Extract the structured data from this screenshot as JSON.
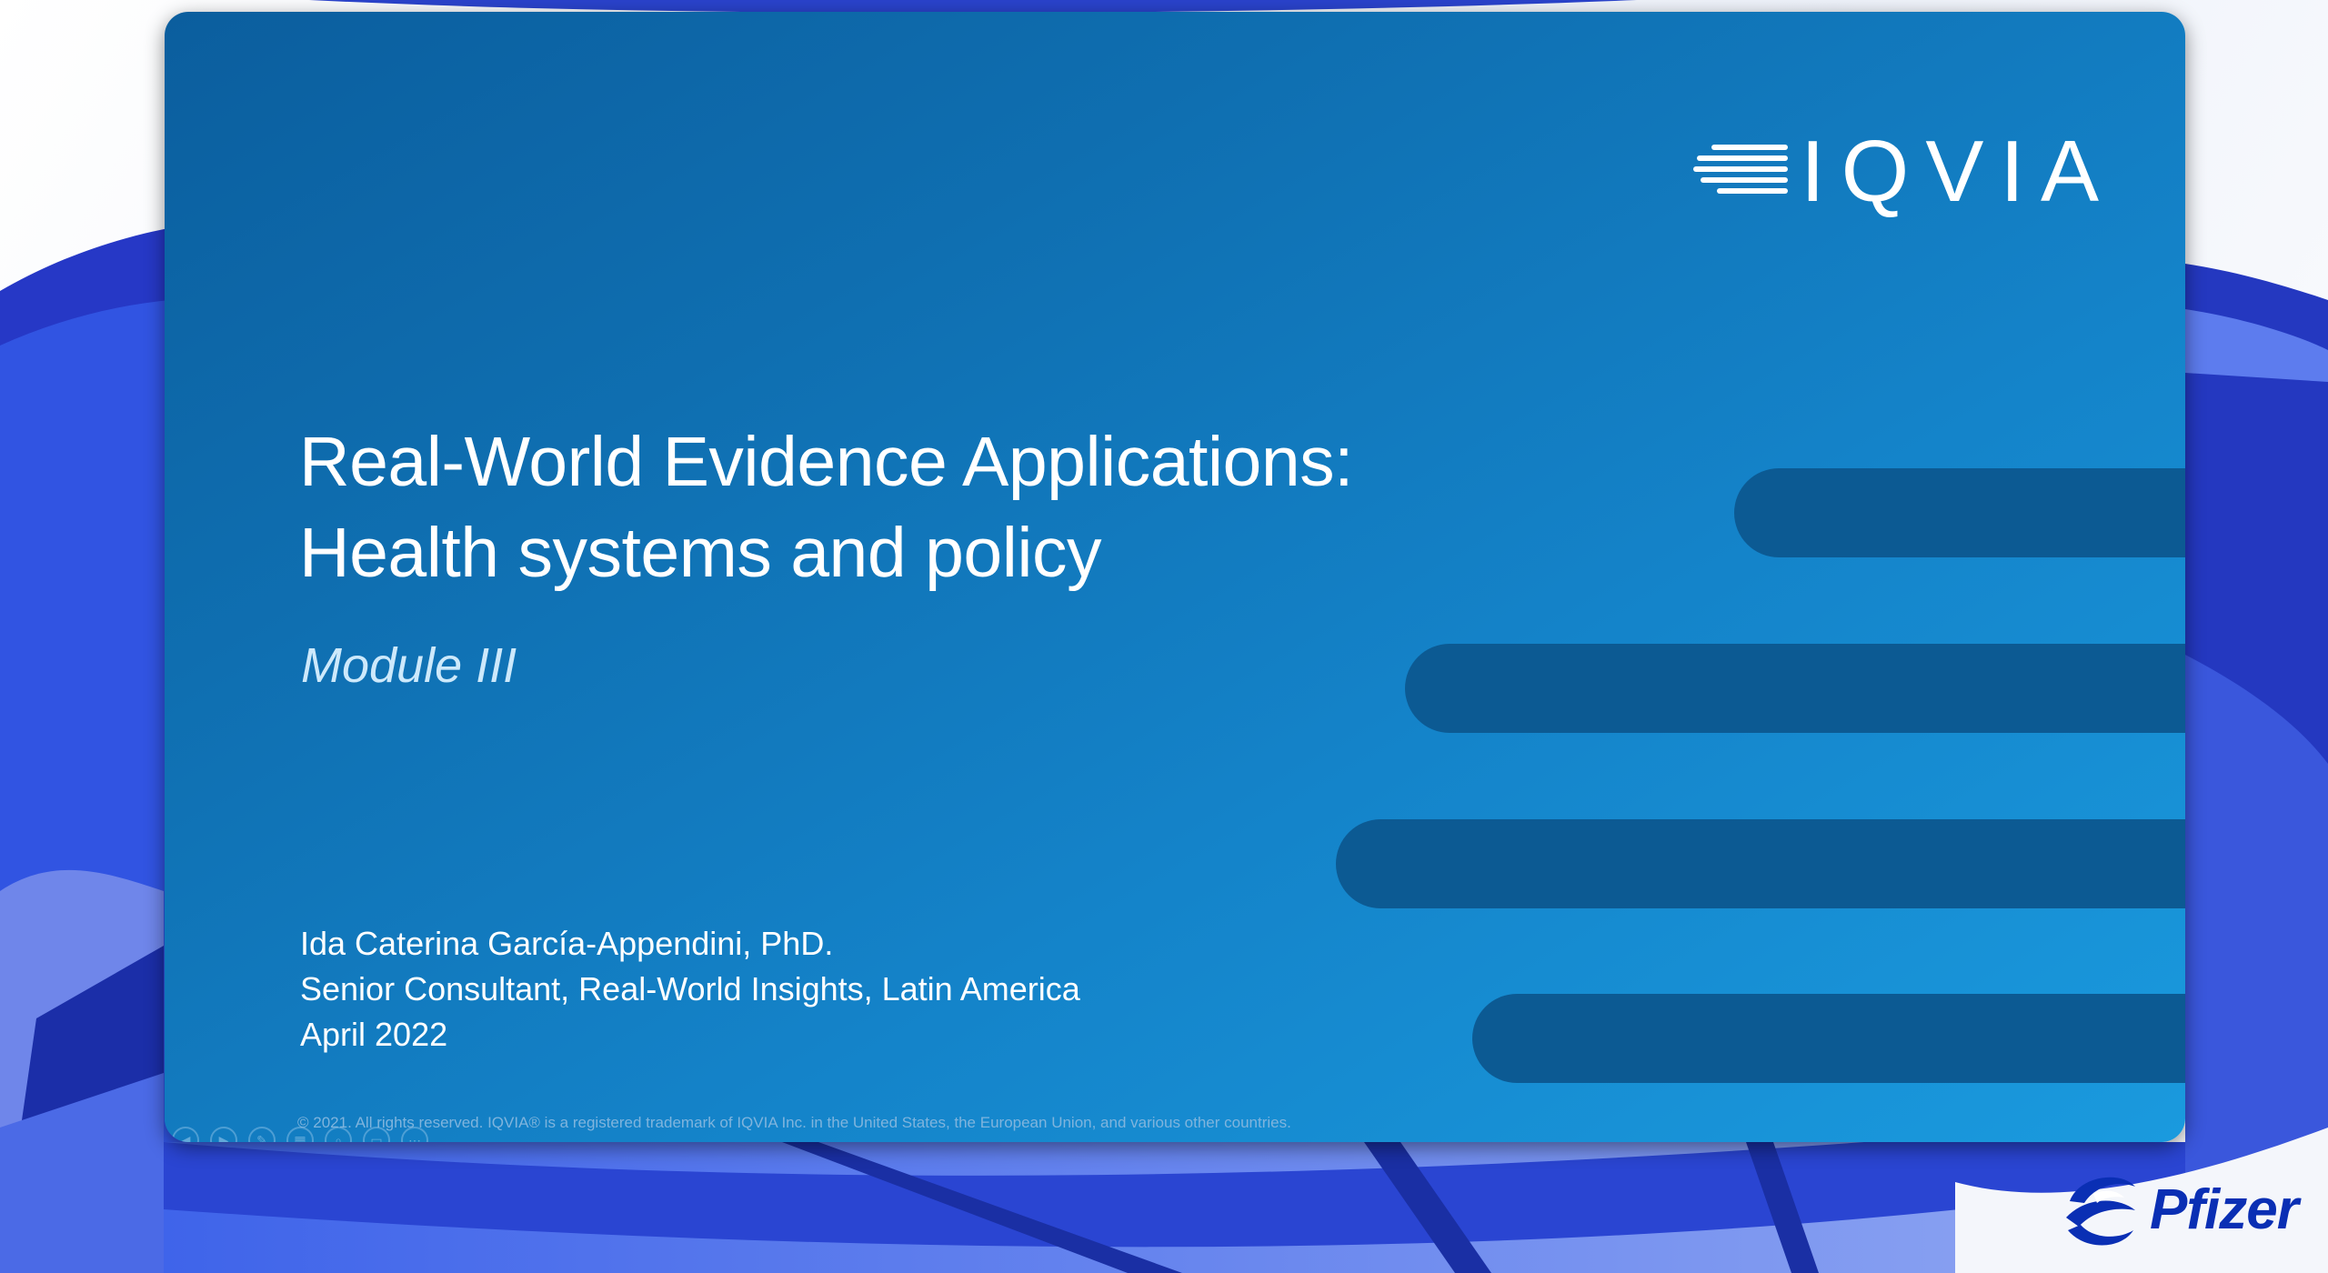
{
  "slide": {
    "logo_text": "IQVIA",
    "title_line1": "Real-World Evidence Applications:",
    "title_line2": "Health systems and policy",
    "subtitle": "Module III",
    "presenter_name": "Ida Caterina García-Appendini, PhD.",
    "presenter_role": "Senior Consultant, Real-World Insights, Latin America",
    "presenter_date": "April 2022",
    "copyright": "© 2021. All rights reserved. IQVIA® is a registered trademark of IQVIA Inc. in the United States, the European Union, and various other countries."
  },
  "controls": [
    {
      "name": "previous-slide-icon",
      "glyph": "◀"
    },
    {
      "name": "next-slide-icon",
      "glyph": "▶"
    },
    {
      "name": "pen-icon",
      "glyph": "✎"
    },
    {
      "name": "slides-grid-icon",
      "glyph": "▦"
    },
    {
      "name": "zoom-icon",
      "glyph": "⌕"
    },
    {
      "name": "subtitles-icon",
      "glyph": "▭"
    },
    {
      "name": "more-options-icon",
      "glyph": "⋯"
    }
  ],
  "branding": {
    "sponsor": "Pfizer"
  },
  "colors": {
    "slide_gradient_start": "#0b5e9e",
    "slide_gradient_end": "#1a9ade",
    "bar": "#0c5a93",
    "subtitle": "#cde9fb",
    "pfizer_blue": "#0a2fb4"
  }
}
